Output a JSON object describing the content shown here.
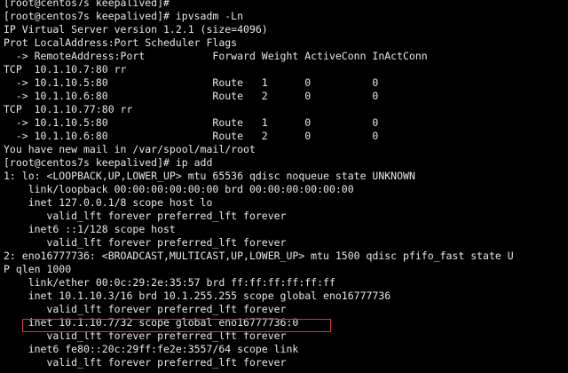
{
  "terminal": {
    "lines": [
      "[root@centos7s keepalived]#",
      "[root@centos7s keepalived]# ipvsadm -Ln",
      "IP Virtual Server version 1.2.1 (size=4096)",
      "Prot LocalAddress:Port Scheduler Flags",
      "  -> RemoteAddress:Port           Forward Weight ActiveConn InActConn",
      "TCP  10.1.10.7:80 rr",
      "  -> 10.1.10.5:80                 Route   1      0          0",
      "  -> 10.1.10.6:80                 Route   2      0          0",
      "TCP  10.1.10.77:80 rr",
      "  -> 10.1.10.5:80                 Route   1      0          0",
      "  -> 10.1.10.6:80                 Route   2      0          0",
      "You have new mail in /var/spool/mail/root",
      "[root@centos7s keepalived]# ip add",
      "1: lo: <LOOPBACK,UP,LOWER_UP> mtu 65536 qdisc noqueue state UNKNOWN",
      "    link/loopback 00:00:00:00:00:00 brd 00:00:00:00:00:00",
      "    inet 127.0.0.1/8 scope host lo",
      "       valid_lft forever preferred_lft forever",
      "    inet6 ::1/128 scope host",
      "       valid_lft forever preferred_lft forever",
      "2: eno16777736: <BROADCAST,MULTICAST,UP,LOWER_UP> mtu 1500 qdisc pfifo_fast state U",
      "P qlen 1000",
      "    link/ether 00:0c:29:2e:35:57 brd ff:ff:ff:ff:ff:ff",
      "    inet 10.1.10.3/16 brd 10.1.255.255 scope global eno16777736",
      "       valid_lft forever preferred_lft forever",
      "    inet 10.1.10.7/32 scope global eno16777736:0",
      "       valid_lft forever preferred_lft forever",
      "    inet6 fe80::20c:29ff:fe2e:3557/64 scope link",
      "       valid_lft forever preferred_lft forever"
    ],
    "highlighted_line": "inet 10.1.10.7/32 scope global eno16777736:0",
    "colors": {
      "background": "#000000",
      "text": "#e8e8e8",
      "highlight_border": "#d83a3a"
    }
  }
}
